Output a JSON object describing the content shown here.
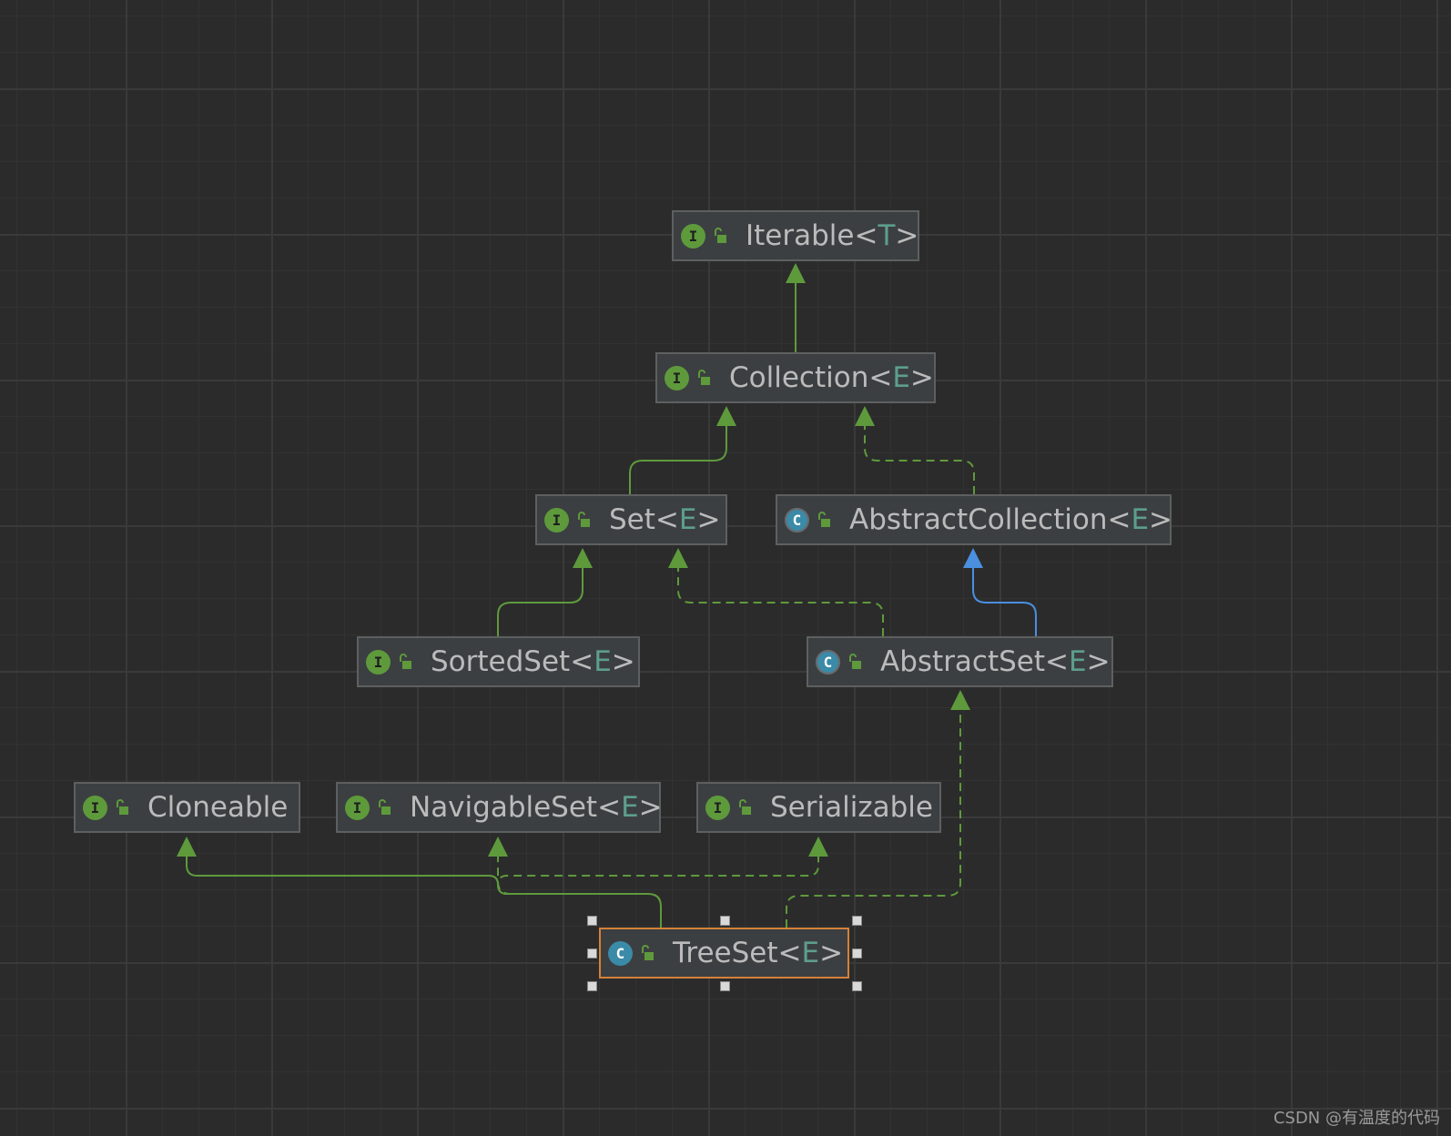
{
  "nodes": [
    {
      "id": "iterable",
      "kind": "interface",
      "name": "Iterable",
      "type_param": "T"
    },
    {
      "id": "collection",
      "kind": "interface",
      "name": "Collection",
      "type_param": "E"
    },
    {
      "id": "set",
      "kind": "interface",
      "name": "Set",
      "type_param": "E"
    },
    {
      "id": "abstract-collection",
      "kind": "abstract-class",
      "name": "AbstractCollection",
      "type_param": "E"
    },
    {
      "id": "sorted-set",
      "kind": "interface",
      "name": "SortedSet",
      "type_param": "E"
    },
    {
      "id": "abstract-set",
      "kind": "abstract-class",
      "name": "AbstractSet",
      "type_param": "E"
    },
    {
      "id": "cloneable",
      "kind": "interface",
      "name": "Cloneable",
      "type_param": ""
    },
    {
      "id": "navigable-set",
      "kind": "interface",
      "name": "NavigableSet",
      "type_param": "E"
    },
    {
      "id": "serializable",
      "kind": "interface",
      "name": "Serializable",
      "type_param": ""
    },
    {
      "id": "tree-set",
      "kind": "class",
      "name": "TreeSet",
      "type_param": "E",
      "selected": true
    }
  ],
  "edges": [
    {
      "from": "collection",
      "to": "iterable",
      "relation": "extends"
    },
    {
      "from": "set",
      "to": "collection",
      "relation": "extends"
    },
    {
      "from": "abstract-collection",
      "to": "collection",
      "relation": "implements"
    },
    {
      "from": "sorted-set",
      "to": "set",
      "relation": "extends"
    },
    {
      "from": "abstract-set",
      "to": "set",
      "relation": "implements"
    },
    {
      "from": "abstract-set",
      "to": "abstract-collection",
      "relation": "class-extends"
    },
    {
      "from": "navigable-set",
      "to": "sorted-set",
      "relation": "extends"
    },
    {
      "from": "tree-set",
      "to": "cloneable",
      "relation": "implements"
    },
    {
      "from": "tree-set",
      "to": "navigable-set",
      "relation": "implements"
    },
    {
      "from": "tree-set",
      "to": "serializable",
      "relation": "implements"
    },
    {
      "from": "tree-set",
      "to": "abstract-set",
      "relation": "class-extends"
    }
  ],
  "badges": {
    "interface": "I",
    "class": "C",
    "abstract-class": "C"
  },
  "colors": {
    "interface_edge": "#5e9a3c",
    "class_edge": "#4a8fe0",
    "selection_border": "#d5813a",
    "type_param": "#5d9e8c"
  },
  "watermark": "CSDN @有温度的代码"
}
